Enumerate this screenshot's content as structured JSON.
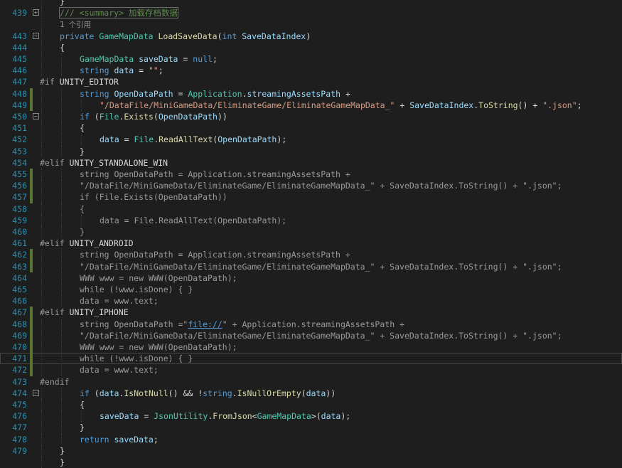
{
  "editor": {
    "colors": {
      "background": "#1e1e1e",
      "line_number": "#2b91af",
      "keyword": "#569cd6",
      "type": "#4ec9b0",
      "identifier": "#9cdcfe",
      "method": "#dcdcaa",
      "string": "#d69d85",
      "comment": "#57a64a",
      "change_bar": "#577430"
    },
    "lines": [
      {
        "num": "",
        "indent": 1,
        "bar": "none",
        "fold": "",
        "tokens": [
          {
            "t": "pn",
            "v": "}"
          }
        ]
      },
      {
        "num": "439",
        "indent": 1,
        "bar": "none",
        "fold": "+",
        "box": true,
        "tokens": [
          {
            "t": "xml",
            "v": "/// <summary> 加载存档数据"
          }
        ]
      },
      {
        "num": "",
        "indent": 1,
        "bar": "none",
        "fold": "",
        "tokens": [
          {
            "t": "ref",
            "v": "1 个引用"
          }
        ]
      },
      {
        "num": "443",
        "indent": 1,
        "bar": "none",
        "fold": "-",
        "tokens": [
          {
            "t": "kw",
            "v": "private "
          },
          {
            "t": "type",
            "v": "GameMapData "
          },
          {
            "t": "mth",
            "v": "LoadSaveData"
          },
          {
            "t": "pn",
            "v": "("
          },
          {
            "t": "kw",
            "v": "int "
          },
          {
            "t": "id",
            "v": "SaveDataIndex"
          },
          {
            "t": "pn",
            "v": ")"
          }
        ]
      },
      {
        "num": "444",
        "indent": 1,
        "bar": "none",
        "fold": "",
        "tokens": [
          {
            "t": "pn",
            "v": "{"
          }
        ]
      },
      {
        "num": "445",
        "indent": 2,
        "bar": "none",
        "fold": "",
        "tokens": [
          {
            "t": "type",
            "v": "GameMapData "
          },
          {
            "t": "id",
            "v": "saveData"
          },
          {
            "t": "pn",
            "v": " = "
          },
          {
            "t": "kw",
            "v": "null"
          },
          {
            "t": "pn",
            "v": ";"
          }
        ]
      },
      {
        "num": "446",
        "indent": 2,
        "bar": "none",
        "fold": "",
        "tokens": [
          {
            "t": "kw",
            "v": "string "
          },
          {
            "t": "id",
            "v": "data"
          },
          {
            "t": "pn",
            "v": " = "
          },
          {
            "t": "str",
            "v": "\"\""
          },
          {
            "t": "pn",
            "v": ";"
          }
        ]
      },
      {
        "num": "447",
        "indent": 0,
        "bar": "none",
        "fold": "",
        "tokens": [
          {
            "t": "pp",
            "v": "#if "
          },
          {
            "t": "pn",
            "v": "UNITY_EDITOR"
          }
        ]
      },
      {
        "num": "448",
        "indent": 2,
        "bar": "green",
        "fold": "",
        "tokens": [
          {
            "t": "kw",
            "v": "string "
          },
          {
            "t": "id",
            "v": "OpenDataPath"
          },
          {
            "t": "pn",
            "v": " = "
          },
          {
            "t": "type",
            "v": "Application"
          },
          {
            "t": "pn",
            "v": "."
          },
          {
            "t": "id",
            "v": "streamingAssetsPath"
          },
          {
            "t": "pn",
            "v": " +"
          }
        ]
      },
      {
        "num": "449",
        "indent": 3,
        "bar": "green",
        "fold": "",
        "tokens": [
          {
            "t": "str",
            "v": "\"/DataFile/MiniGameData/EliminateGame/EliminateGameMapData_\""
          },
          {
            "t": "pn",
            "v": " + "
          },
          {
            "t": "id",
            "v": "SaveDataIndex"
          },
          {
            "t": "pn",
            "v": "."
          },
          {
            "t": "mth",
            "v": "ToString"
          },
          {
            "t": "pn",
            "v": "() + "
          },
          {
            "t": "str",
            "v": "\".json\""
          },
          {
            "t": "pn",
            "v": ";"
          }
        ]
      },
      {
        "num": "450",
        "indent": 2,
        "bar": "none",
        "fold": "-",
        "tokens": [
          {
            "t": "kw",
            "v": "if "
          },
          {
            "t": "pn",
            "v": "("
          },
          {
            "t": "type",
            "v": "File"
          },
          {
            "t": "pn",
            "v": "."
          },
          {
            "t": "mth",
            "v": "Exists"
          },
          {
            "t": "pn",
            "v": "("
          },
          {
            "t": "id",
            "v": "OpenDataPath"
          },
          {
            "t": "pn",
            "v": "))"
          }
        ]
      },
      {
        "num": "451",
        "indent": 2,
        "bar": "none",
        "fold": "",
        "tokens": [
          {
            "t": "pn",
            "v": "{"
          }
        ]
      },
      {
        "num": "452",
        "indent": 3,
        "bar": "none",
        "fold": "",
        "tokens": [
          {
            "t": "id",
            "v": "data"
          },
          {
            "t": "pn",
            "v": " = "
          },
          {
            "t": "type",
            "v": "File"
          },
          {
            "t": "pn",
            "v": "."
          },
          {
            "t": "mth",
            "v": "ReadAllText"
          },
          {
            "t": "pn",
            "v": "("
          },
          {
            "t": "id",
            "v": "OpenDataPath"
          },
          {
            "t": "pn",
            "v": ");"
          }
        ]
      },
      {
        "num": "453",
        "indent": 2,
        "bar": "none",
        "fold": "",
        "tokens": [
          {
            "t": "pn",
            "v": "}"
          }
        ]
      },
      {
        "num": "454",
        "indent": 0,
        "bar": "none",
        "fold": "",
        "tokens": [
          {
            "t": "pp",
            "v": "#elif "
          },
          {
            "t": "pn",
            "v": "UNITY_STANDALONE_WIN"
          }
        ]
      },
      {
        "num": "455",
        "indent": 2,
        "bar": "green",
        "fold": "",
        "tokens": [
          {
            "t": "dis",
            "v": "string OpenDataPath = Application.streamingAssetsPath +"
          }
        ]
      },
      {
        "num": "456",
        "indent": 2,
        "bar": "green",
        "fold": "",
        "tokens": [
          {
            "t": "dis",
            "v": "\"/DataFile/MiniGameData/EliminateGame/EliminateGameMapData_\" + SaveDataIndex.ToString() + \".json\";"
          }
        ]
      },
      {
        "num": "457",
        "indent": 2,
        "bar": "green",
        "fold": "",
        "tokens": [
          {
            "t": "dis",
            "v": "if (File.Exists(OpenDataPath))"
          }
        ]
      },
      {
        "num": "458",
        "indent": 2,
        "bar": "none",
        "fold": "",
        "tokens": [
          {
            "t": "dis",
            "v": "{"
          }
        ]
      },
      {
        "num": "459",
        "indent": 3,
        "bar": "none",
        "fold": "",
        "tokens": [
          {
            "t": "dis",
            "v": "data = File.ReadAllText(OpenDataPath);"
          }
        ]
      },
      {
        "num": "460",
        "indent": 2,
        "bar": "none",
        "fold": "",
        "tokens": [
          {
            "t": "dis",
            "v": "}"
          }
        ]
      },
      {
        "num": "461",
        "indent": 0,
        "bar": "none",
        "fold": "",
        "tokens": [
          {
            "t": "pp",
            "v": "#elif "
          },
          {
            "t": "pn",
            "v": "UNITY_ANDROID"
          }
        ]
      },
      {
        "num": "462",
        "indent": 2,
        "bar": "green",
        "fold": "",
        "tokens": [
          {
            "t": "dis",
            "v": "string OpenDataPath = Application.streamingAssetsPath +"
          }
        ]
      },
      {
        "num": "463",
        "indent": 2,
        "bar": "green",
        "fold": "",
        "tokens": [
          {
            "t": "dis",
            "v": "\"/DataFile/MiniGameData/EliminateGame/EliminateGameMapData_\" + SaveDataIndex.ToString() + \".json\";"
          }
        ]
      },
      {
        "num": "464",
        "indent": 2,
        "bar": "none",
        "fold": "",
        "tokens": [
          {
            "t": "dis",
            "v": "WWW www = new WWW(OpenDataPath);"
          }
        ]
      },
      {
        "num": "465",
        "indent": 2,
        "bar": "none",
        "fold": "",
        "tokens": [
          {
            "t": "dis",
            "v": "while (!www.isDone) { }"
          }
        ]
      },
      {
        "num": "466",
        "indent": 2,
        "bar": "none",
        "fold": "",
        "tokens": [
          {
            "t": "dis",
            "v": "data = www.text;"
          }
        ]
      },
      {
        "num": "467",
        "indent": 0,
        "bar": "green",
        "fold": "",
        "tokens": [
          {
            "t": "pp",
            "v": "#elif "
          },
          {
            "t": "pn",
            "v": "UNITY_IPHONE"
          }
        ]
      },
      {
        "num": "468",
        "indent": 2,
        "bar": "green",
        "fold": "",
        "tokens": [
          {
            "t": "dis",
            "v": "string OpenDataPath =\""
          },
          {
            "t": "lnk",
            "v": "file://"
          },
          {
            "t": "dis",
            "v": "\" + Application.streamingAssetsPath +"
          }
        ]
      },
      {
        "num": "469",
        "indent": 2,
        "bar": "green",
        "fold": "",
        "tokens": [
          {
            "t": "dis",
            "v": "\"/DataFile/MiniGameData/EliminateGame/EliminateGameMapData_\" + SaveDataIndex.ToString() + \".json\";"
          }
        ]
      },
      {
        "num": "470",
        "indent": 2,
        "bar": "green",
        "fold": "",
        "tokens": [
          {
            "t": "dis",
            "v": "WWW www = new WWW(OpenDataPath);"
          }
        ]
      },
      {
        "num": "471",
        "indent": 2,
        "bar": "green",
        "fold": "",
        "current": true,
        "tokens": [
          {
            "t": "dis",
            "v": "while (!www.isDone) { }"
          }
        ]
      },
      {
        "num": "472",
        "indent": 2,
        "bar": "green",
        "fold": "",
        "tokens": [
          {
            "t": "dis",
            "v": "data = www.text;"
          }
        ]
      },
      {
        "num": "473",
        "indent": 0,
        "bar": "none",
        "fold": "",
        "tokens": [
          {
            "t": "pp",
            "v": "#endif"
          }
        ]
      },
      {
        "num": "474",
        "indent": 2,
        "bar": "none",
        "fold": "-",
        "tokens": [
          {
            "t": "kw",
            "v": "if "
          },
          {
            "t": "pn",
            "v": "("
          },
          {
            "t": "id",
            "v": "data"
          },
          {
            "t": "pn",
            "v": "."
          },
          {
            "t": "mth",
            "v": "IsNotNull"
          },
          {
            "t": "pn",
            "v": "() && !"
          },
          {
            "t": "kw",
            "v": "string"
          },
          {
            "t": "pn",
            "v": "."
          },
          {
            "t": "mth",
            "v": "IsNullOrEmpty"
          },
          {
            "t": "pn",
            "v": "("
          },
          {
            "t": "id",
            "v": "data"
          },
          {
            "t": "pn",
            "v": "))"
          }
        ]
      },
      {
        "num": "475",
        "indent": 2,
        "bar": "none",
        "fold": "",
        "tokens": [
          {
            "t": "pn",
            "v": "{"
          }
        ]
      },
      {
        "num": "476",
        "indent": 3,
        "bar": "none",
        "fold": "",
        "tokens": [
          {
            "t": "id",
            "v": "saveData"
          },
          {
            "t": "pn",
            "v": " = "
          },
          {
            "t": "type",
            "v": "JsonUtility"
          },
          {
            "t": "pn",
            "v": "."
          },
          {
            "t": "mth",
            "v": "FromJson"
          },
          {
            "t": "pn",
            "v": "<"
          },
          {
            "t": "type",
            "v": "GameMapData"
          },
          {
            "t": "pn",
            "v": ">("
          },
          {
            "t": "id",
            "v": "data"
          },
          {
            "t": "pn",
            "v": ");"
          }
        ]
      },
      {
        "num": "477",
        "indent": 2,
        "bar": "none",
        "fold": "",
        "tokens": [
          {
            "t": "pn",
            "v": "}"
          }
        ]
      },
      {
        "num": "478",
        "indent": 2,
        "bar": "none",
        "fold": "",
        "tokens": [
          {
            "t": "kw",
            "v": "return "
          },
          {
            "t": "id",
            "v": "saveData"
          },
          {
            "t": "pn",
            "v": ";"
          }
        ]
      },
      {
        "num": "479",
        "indent": 1,
        "bar": "none",
        "fold": "",
        "tokens": [
          {
            "t": "pn",
            "v": "}"
          }
        ]
      },
      {
        "num": "",
        "indent": 1,
        "bar": "none",
        "fold": "",
        "tokens": [
          {
            "t": "pn",
            "v": "}"
          }
        ]
      }
    ]
  }
}
